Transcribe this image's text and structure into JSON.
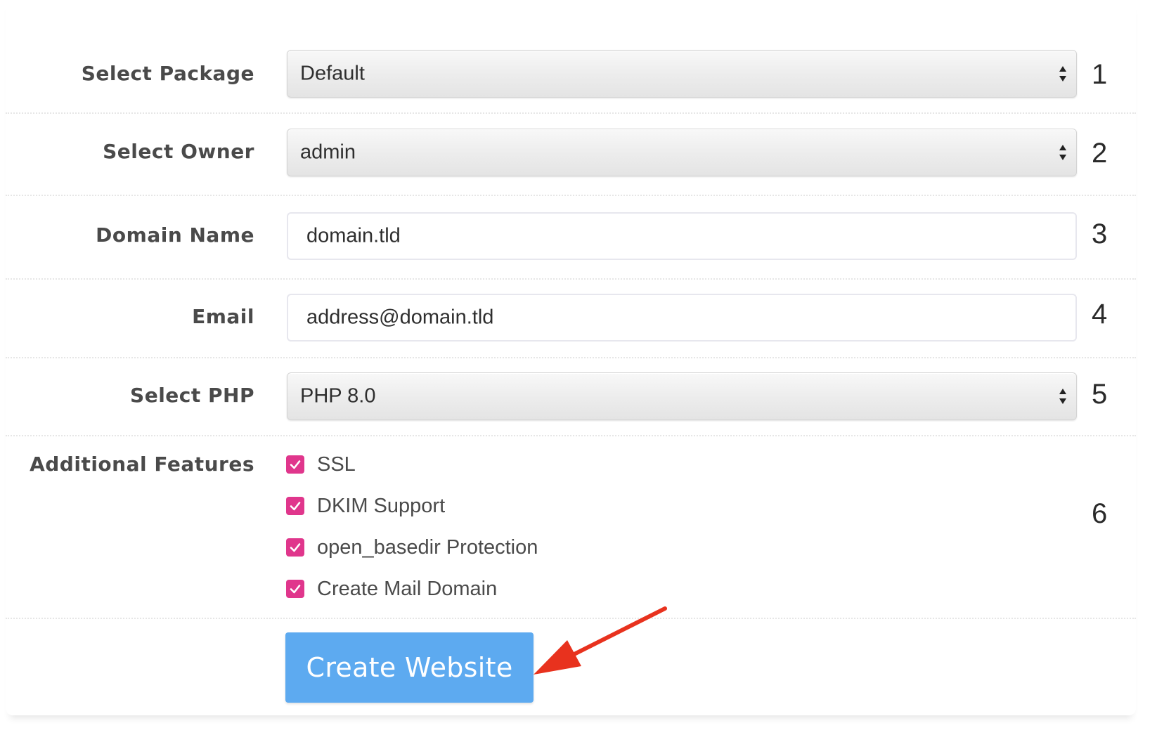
{
  "form": {
    "package": {
      "label": "Select Package",
      "value": "Default",
      "step": "1"
    },
    "owner": {
      "label": "Select Owner",
      "value": "admin",
      "step": "2"
    },
    "domain": {
      "label": "Domain Name",
      "value": "domain.tld",
      "step": "3"
    },
    "email": {
      "label": "Email",
      "value": "address@domain.tld",
      "step": "4"
    },
    "php": {
      "label": "Select PHP",
      "value": "PHP 8.0",
      "step": "5"
    },
    "features": {
      "label": "Additional Features",
      "step": "6",
      "items": [
        {
          "label": "SSL",
          "checked": true
        },
        {
          "label": "DKIM Support",
          "checked": true
        },
        {
          "label": "open_basedir Protection",
          "checked": true
        },
        {
          "label": "Create Mail Domain",
          "checked": true
        }
      ]
    },
    "submit_label": "Create Website"
  },
  "colors": {
    "checkbox": "#e0368c",
    "button": "#5daaf0",
    "annotation_arrow": "#e8321e"
  },
  "icons": {
    "select_arrows": "up-down-arrows-icon",
    "checkmark": "checkmark-icon",
    "annotation": "red-arrow-icon"
  }
}
